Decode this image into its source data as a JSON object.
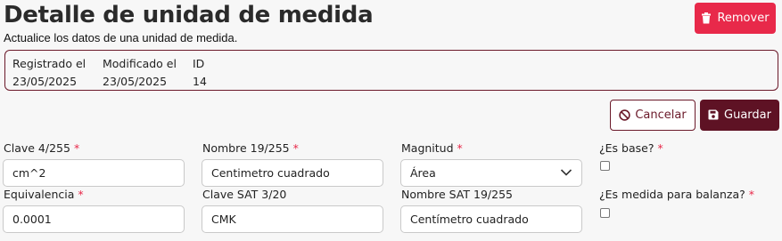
{
  "page": {
    "title": "Detalle de unidad de medida",
    "subtitle": "Actualice los datos de una unidad de medida."
  },
  "actions": {
    "remove_label": "Remover",
    "cancel_label": "Cancelar",
    "save_label": "Guardar"
  },
  "info": {
    "registered_label": "Registrado el",
    "registered_value": "23/05/2025",
    "modified_label": "Modificado el",
    "modified_value": "23/05/2025",
    "id_label": "ID",
    "id_value": "14"
  },
  "form": {
    "clave": {
      "label": "Clave 4/255",
      "required": "*",
      "value": "cm^2"
    },
    "nombre": {
      "label": "Nombre 19/255",
      "required": "*",
      "value": "Centimetro cuadrado"
    },
    "magnitud": {
      "label": "Magnitud",
      "required": "*",
      "value": "Área"
    },
    "es_base": {
      "label": "¿Es base?",
      "required": "*",
      "checked": false
    },
    "equivalencia": {
      "label": "Equivalencia",
      "required": "*",
      "value": "0.0001"
    },
    "clave_sat": {
      "label": "Clave SAT 3/20",
      "value": "CMK"
    },
    "nombre_sat": {
      "label": "Nombre SAT 19/255",
      "value": "Centímetro cuadrado"
    },
    "es_balanza": {
      "label": "¿Es medida para balanza?",
      "required": "*",
      "checked": false
    }
  },
  "colors": {
    "danger": "#e8294a",
    "primary_dark": "#5e1224",
    "outline": "#6b1a2a"
  },
  "icons": {
    "remove": "trash-icon",
    "cancel": "ban-icon",
    "save": "floppy-disk-icon",
    "select": "chevron-down-icon"
  }
}
